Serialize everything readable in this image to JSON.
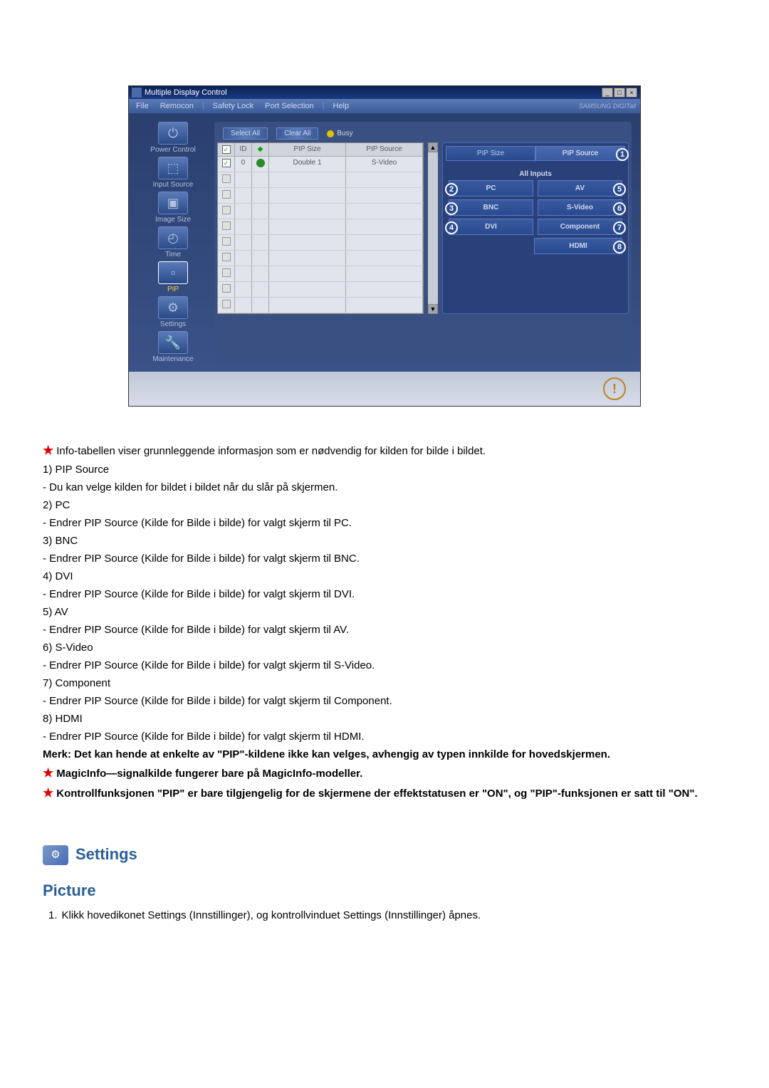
{
  "window": {
    "title": "Multiple Display Control"
  },
  "menu": {
    "file": "File",
    "remocon": "Remocon",
    "safety_lock": "Safety Lock",
    "port_selection": "Port Selection",
    "help": "Help",
    "brand": "SAMSUNG DIGITall"
  },
  "sidebar": {
    "power_control": "Power Control",
    "input_source": "Input Source",
    "image_size": "Image Size",
    "time": "Time",
    "pip": "PIP",
    "settings": "Settings",
    "maintenance": "Maintenance"
  },
  "toolbar": {
    "select_all": "Select All",
    "clear_all": "Clear All",
    "busy": "Busy"
  },
  "table": {
    "h_id": "ID",
    "h_pip_size": "PIP Size",
    "h_pip_source": "PIP Source",
    "row1_id": "0",
    "row1_size": "Double 1",
    "row1_source": "S-Video"
  },
  "tabs": {
    "pip_size": "PIP Size",
    "pip_source": "PIP Source",
    "badge1": "1"
  },
  "inputs": {
    "title": "All Inputs",
    "pc": "PC",
    "av": "AV",
    "bnc": "BNC",
    "svideo": "S-Video",
    "dvi": "DVI",
    "component": "Component",
    "hdmi": "HDMI",
    "b2": "2",
    "b3": "3",
    "b4": "4",
    "b5": "5",
    "b6": "6",
    "b7": "7",
    "b8": "8"
  },
  "doc": {
    "intro": "Info-tabellen viser grunnleggende informasjon som er nødvendig for kilden for bilde i bildet.",
    "i1_t": "1)  PIP Source",
    "i1_d": "- Du kan velge kilden for bildet i bildet når du slår på skjermen.",
    "i2_t": "2)  PC",
    "i2_d": "- Endrer PIP Source (Kilde for Bilde i bilde) for valgt skjerm til PC.",
    "i3_t": "3)  BNC",
    "i3_d": "- Endrer PIP Source (Kilde for Bilde i bilde) for valgt skjerm til BNC.",
    "i4_t": "4)  DVI",
    "i4_d": "- Endrer PIP Source (Kilde for Bilde i bilde) for valgt skjerm til DVI.",
    "i5_t": "5)  AV",
    "i5_d": "- Endrer PIP Source (Kilde for Bilde i bilde) for valgt skjerm til AV.",
    "i6_t": "6)  S-Video",
    "i6_d": "- Endrer PIP Source (Kilde for Bilde i bilde) for valgt skjerm til S-Video.",
    "i7_t": "7)  Component",
    "i7_d": "- Endrer PIP Source (Kilde for Bilde i bilde) for valgt skjerm til Component.",
    "i8_t": "8)  HDMI",
    "i8_d": "- Endrer PIP Source (Kilde for Bilde i bilde) for valgt skjerm til HDMI.",
    "note": "Merk: Det kan hende at enkelte av \"PIP\"-kildene ikke kan velges, avhengig av typen innkilde for hovedskjermen.",
    "star1": "MagicInfo—signalkilde fungerer bare på MagicInfo-modeller.",
    "star2": "Kontrollfunksjonen \"PIP\" er bare tilgjengelig for de skjermene der effektstatusen er \"ON\", og \"PIP\"-funksjonen er satt til \"ON\".",
    "settings_h": "Settings",
    "picture_h": "Picture",
    "picture_1": "Klikk hovedikonet Settings (Innstillinger), og kontrollvinduet Settings (Innstillinger) åpnes."
  }
}
